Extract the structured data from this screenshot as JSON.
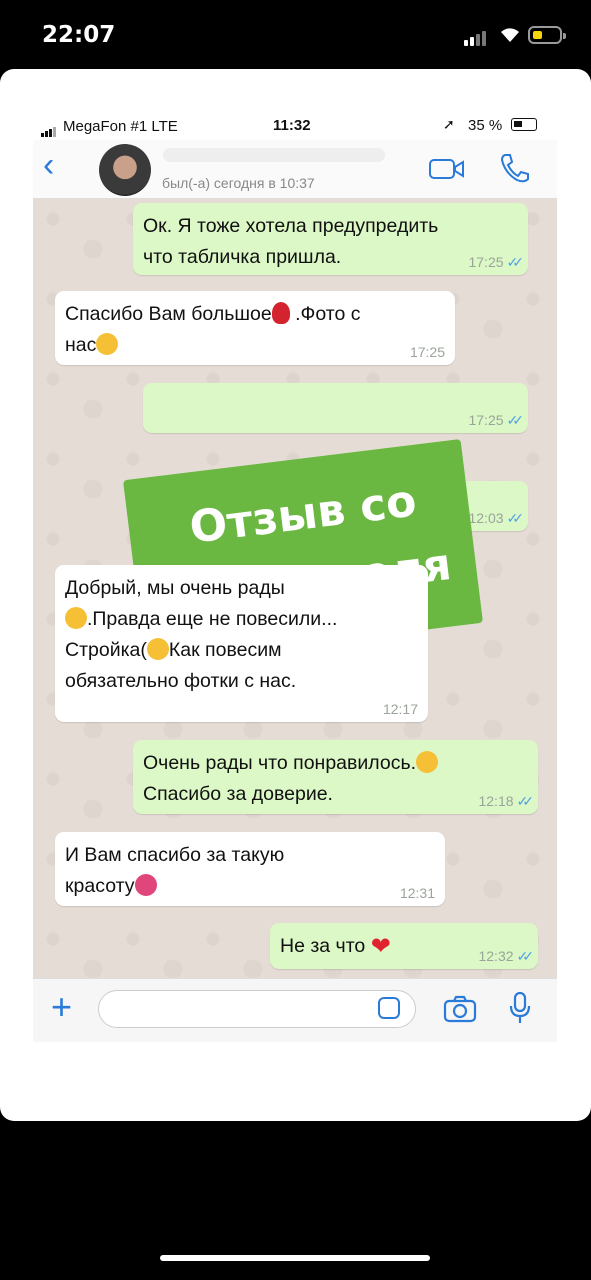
{
  "outer_status": {
    "time": "22:07"
  },
  "inner_status": {
    "carrier": "MegaFon #1  LTE",
    "time": "11:32",
    "battery": "35 %"
  },
  "header": {
    "last_seen": "был(-а) сегодня в 10:37"
  },
  "messages": [
    {
      "dir": "out",
      "lines": [
        "Ок. Я тоже хотела предупредить",
        "что табличка пришла."
      ],
      "time": "17:25"
    },
    {
      "dir": "in",
      "lines": [
        "Спасибо  Вам большое",
        ".Фото с",
        "нас"
      ],
      "time": "17:25"
    },
    {
      "dir": "out",
      "lines": [
        ""
      ],
      "time": "17:25"
    },
    {
      "dir": "out",
      "lines": [
        ""
      ],
      "time": "12:03"
    },
    {
      "dir": "in",
      "lines": [
        "Добрый, мы очень рады",
        ".Правда еще не повесили...",
        "Стройка(",
        "Как повесим",
        "обязательно  фотки с нас."
      ],
      "time": "12:17"
    },
    {
      "dir": "out",
      "lines": [
        "Очень рады что понравилось.",
        "Спасибо за доверие."
      ],
      "time": "12:18"
    },
    {
      "dir": "in",
      "lines": [
        "И Вам спасибо за такую",
        "красоту"
      ],
      "time": "12:31"
    },
    {
      "dir": "out",
      "lines": [
        "Не за что"
      ],
      "time": "12:32"
    }
  ],
  "banner": {
    "line1": "Отзыв со",
    "line2": "Ставрополя",
    "color": "#6ab741"
  },
  "colors": {
    "outgoing": "#dcf8c6",
    "incoming": "#ffffff",
    "accent": "#2a7bd9",
    "ticks": "#4fa3e6"
  },
  "icons": [
    "back-icon",
    "video-call-icon",
    "phone-call-icon",
    "plus-icon",
    "sticker-icon",
    "camera-icon",
    "microphone-icon"
  ]
}
